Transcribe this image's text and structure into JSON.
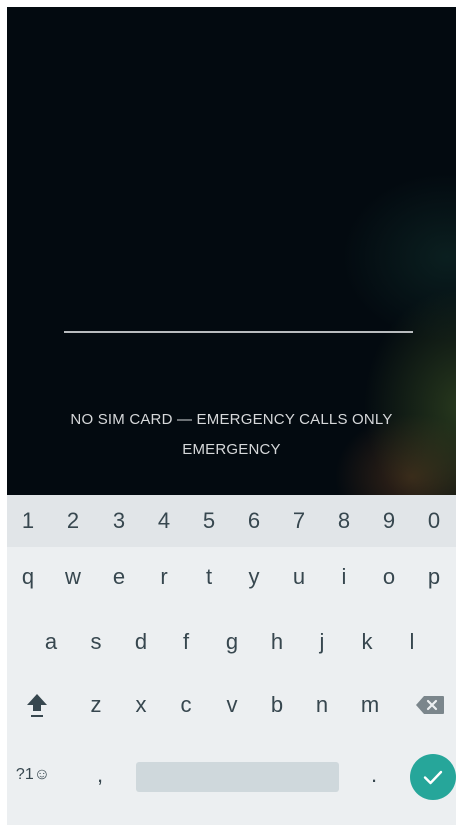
{
  "lockscreen": {
    "status_line_1": "NO SIM CARD — EMERGENCY CALLS ONLY",
    "status_line_2": "EMERGENCY"
  },
  "keyboard": {
    "number_row": [
      "1",
      "2",
      "3",
      "4",
      "5",
      "6",
      "7",
      "8",
      "9",
      "0"
    ],
    "row1": [
      "q",
      "w",
      "e",
      "r",
      "t",
      "y",
      "u",
      "i",
      "o",
      "p"
    ],
    "row2": [
      "a",
      "s",
      "d",
      "f",
      "g",
      "h",
      "j",
      "k",
      "l"
    ],
    "row3": [
      "z",
      "x",
      "c",
      "v",
      "b",
      "n",
      "m"
    ],
    "symbols_label": "?1☺",
    "comma_label": ",",
    "period_label": ".",
    "icons": {
      "shift": "shift-arrow-icon",
      "backspace": "backspace-icon",
      "enter": "checkmark-icon"
    },
    "colors": {
      "background": "#eceff1",
      "key_text": "#37474f",
      "accent": "#26a69a"
    }
  }
}
